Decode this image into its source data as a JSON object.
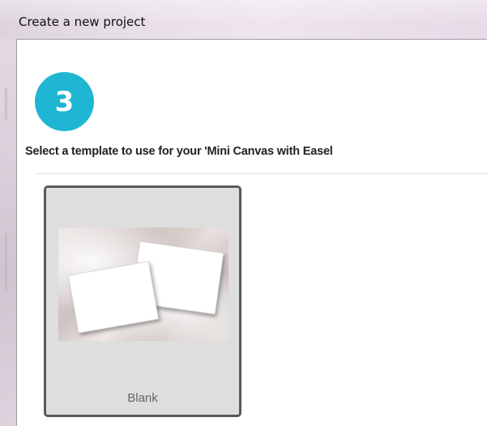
{
  "window": {
    "title": "Create a new project"
  },
  "step": {
    "number": "3"
  },
  "instruction": {
    "text": "Select a template to use for your 'Mini Canvas with Easel"
  },
  "templates": [
    {
      "label": "Blank",
      "selected": true,
      "thumbnail": "two-blank-photo-cards-on-satin"
    }
  ],
  "colors": {
    "step_circle": "#1fb6d3",
    "card_background": "#dedede",
    "card_border": "#5a5a5a"
  }
}
